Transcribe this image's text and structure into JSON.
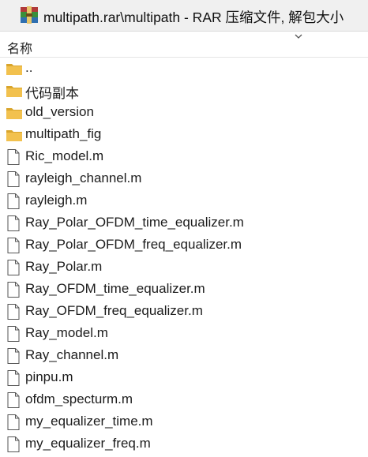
{
  "window": {
    "title": "multipath.rar\\multipath - RAR 压缩文件, 解包大小"
  },
  "column_header": {
    "name_label": "名称"
  },
  "colors": {
    "folder": "#f2c14e",
    "folder_dark": "#d9a52c",
    "file_outline": "#555555"
  },
  "files": [
    {
      "name": "..",
      "type": "folder"
    },
    {
      "name": "代码副本",
      "type": "folder"
    },
    {
      "name": "old_version",
      "type": "folder"
    },
    {
      "name": "multipath_fig",
      "type": "folder"
    },
    {
      "name": "Ric_model.m",
      "type": "file"
    },
    {
      "name": "rayleigh_channel.m",
      "type": "file"
    },
    {
      "name": "rayleigh.m",
      "type": "file"
    },
    {
      "name": "Ray_Polar_OFDM_time_equalizer.m",
      "type": "file"
    },
    {
      "name": "Ray_Polar_OFDM_freq_equalizer.m",
      "type": "file"
    },
    {
      "name": "Ray_Polar.m",
      "type": "file"
    },
    {
      "name": "Ray_OFDM_time_equalizer.m",
      "type": "file"
    },
    {
      "name": "Ray_OFDM_freq_equalizer.m",
      "type": "file"
    },
    {
      "name": "Ray_model.m",
      "type": "file"
    },
    {
      "name": "Ray_channel.m",
      "type": "file"
    },
    {
      "name": "pinpu.m",
      "type": "file"
    },
    {
      "name": "ofdm_specturm.m",
      "type": "file"
    },
    {
      "name": "my_equalizer_time.m",
      "type": "file"
    },
    {
      "name": "my_equalizer_freq.m",
      "type": "file"
    }
  ]
}
